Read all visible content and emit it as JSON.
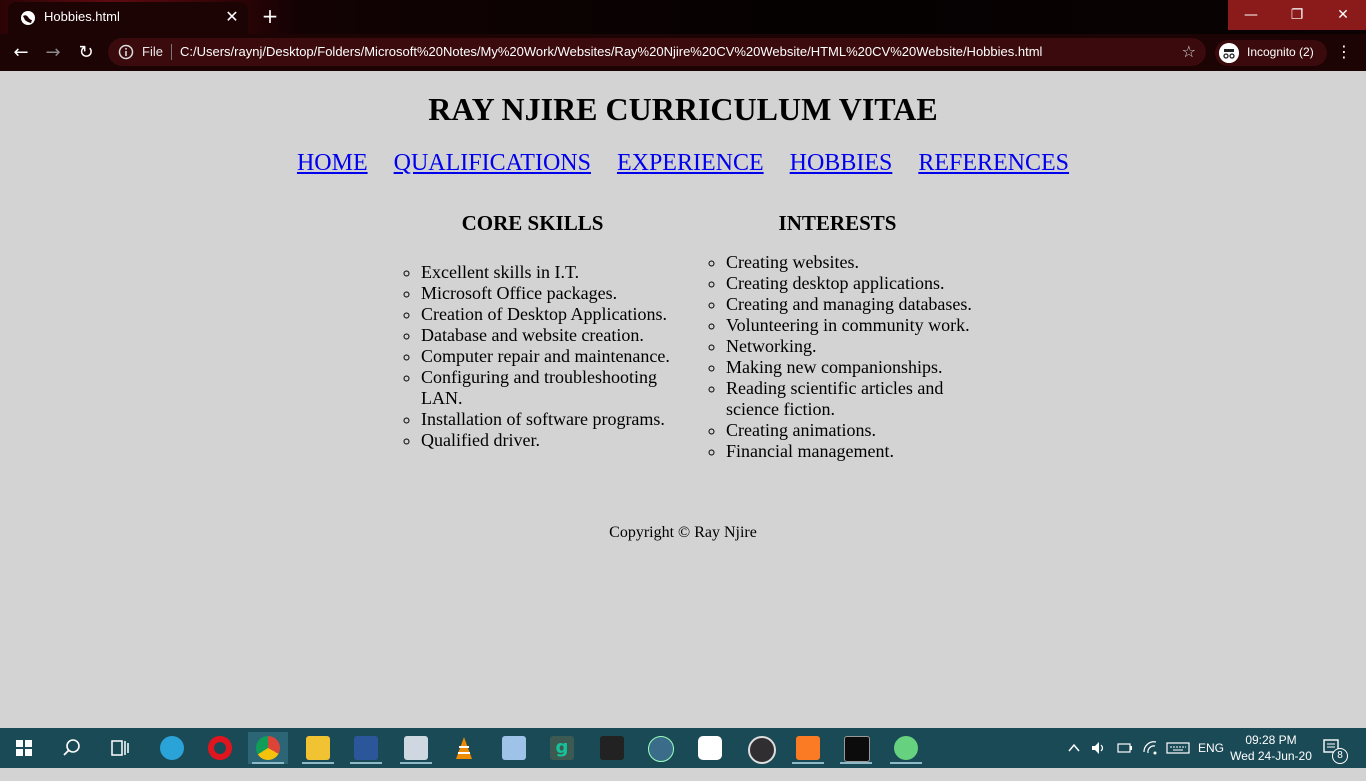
{
  "browser": {
    "tab_title": "Hobbies.html",
    "tab_close": "✕",
    "new_tab": "+",
    "file_label": "File",
    "url": "C:/Users/raynj/Desktop/Folders/Microsoft%20Notes/My%20Work/Websites/Ray%20Njire%20CV%20Website/HTML%20CV%20Website/Hobbies.html",
    "incognito_label": "Incognito (2)",
    "window_min": "—",
    "window_max": "❐",
    "window_close": "✕",
    "back": "←",
    "forward": "→",
    "reload": "↻",
    "star": "☆",
    "menu": "⋮"
  },
  "page": {
    "title": "RAY NJIRE CURRICULUM VITAE",
    "nav": [
      "HOME",
      "QUALIFICATIONS",
      "EXPERIENCE",
      "HOBBIES",
      "REFERENCES"
    ],
    "skills_heading": "CORE SKILLS",
    "skills": [
      "Excellent skills in I.T.",
      "Microsoft Office packages.",
      "Creation of Desktop Applications.",
      "Database and website creation.",
      "Computer repair and maintenance.",
      "Configuring and troubleshooting LAN.",
      "Installation of software programs.",
      "Qualified driver."
    ],
    "interests_heading": "INTERESTS",
    "interests": [
      "Creating websites.",
      "Creating desktop applications.",
      "Creating and managing databases.",
      "Volunteering in community work.",
      "Networking.",
      "Making new companionships.",
      "Reading scientific articles and science fiction.",
      "Creating animations.",
      "Financial management."
    ],
    "copyright": "Copyright © Ray Njire"
  },
  "taskbar": {
    "apps": [
      {
        "name": "start-icon",
        "color": "#ffffff"
      },
      {
        "name": "search-icon",
        "color": "#ffffff"
      },
      {
        "name": "task-view-icon",
        "color": "#ffffff"
      },
      {
        "name": "edge-icon",
        "color": "#2aa3d8"
      },
      {
        "name": "opera-icon",
        "color": "#e0151e"
      },
      {
        "name": "chrome-icon",
        "color": "#f2c01d"
      },
      {
        "name": "file-explorer-icon",
        "color": "#f1c232"
      },
      {
        "name": "word-icon",
        "color": "#2b579a"
      },
      {
        "name": "remote-desktop-icon",
        "color": "#cfd8e0"
      },
      {
        "name": "vlc-icon",
        "color": "#f08a00"
      },
      {
        "name": "virtualbox-icon",
        "color": "#9fc3e8"
      },
      {
        "name": "grammarly-icon",
        "color": "#15c39a"
      },
      {
        "name": "jetpack-icon",
        "color": "#222222"
      },
      {
        "name": "moodle-icon",
        "color": "#3b6d8a"
      },
      {
        "name": "app-shield-icon",
        "color": "#ffffff"
      },
      {
        "name": "obs-icon",
        "color": "#302e31"
      },
      {
        "name": "xampp-icon",
        "color": "#fb7a24"
      },
      {
        "name": "terminal-icon",
        "color": "#0c0c0c"
      },
      {
        "name": "atom-icon",
        "color": "#66d17f"
      }
    ],
    "tray_lang": "ENG",
    "time": "09:28 PM",
    "date": "Wed 24-Jun-20",
    "notification_count": "8"
  }
}
